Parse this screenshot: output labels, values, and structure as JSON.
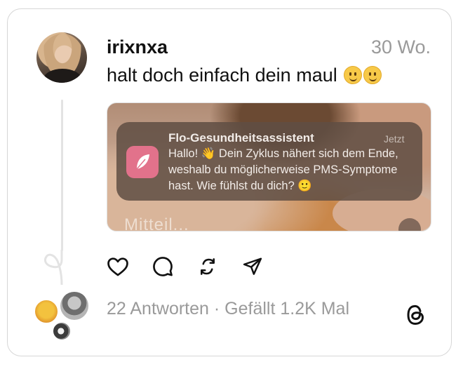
{
  "post": {
    "username": "irixnxa",
    "timestamp": "30 Wo.",
    "text": "halt doch einfach dein maul",
    "text_emojis": [
      "slightly-smiling-face-emoji",
      "slightly-smiling-face-emoji"
    ]
  },
  "media": {
    "caption_partial": "Mitteil...",
    "notification": {
      "app_name": "Flo-Gesundheitsassistent",
      "time": "Jetzt",
      "body": "Hallo! 👋 Dein Zyklus nähert sich dem Ende, weshalb du möglicherweise PMS-Symptome hast. Wie fühlst du dich? 🙂",
      "icon": "flo-feather-icon",
      "icon_color": "#e2728b"
    }
  },
  "actions": {
    "like": "heart-icon",
    "reply": "comment-icon",
    "repost": "repost-icon",
    "share": "send-icon"
  },
  "stats": {
    "text": "22 Antworten · Gefällt 1.2K Mal"
  },
  "branding": {
    "logo": "threads-logo-icon"
  },
  "colors": {
    "text": "#111111",
    "muted": "#9a9a9a",
    "border": "#d6d6d6"
  }
}
